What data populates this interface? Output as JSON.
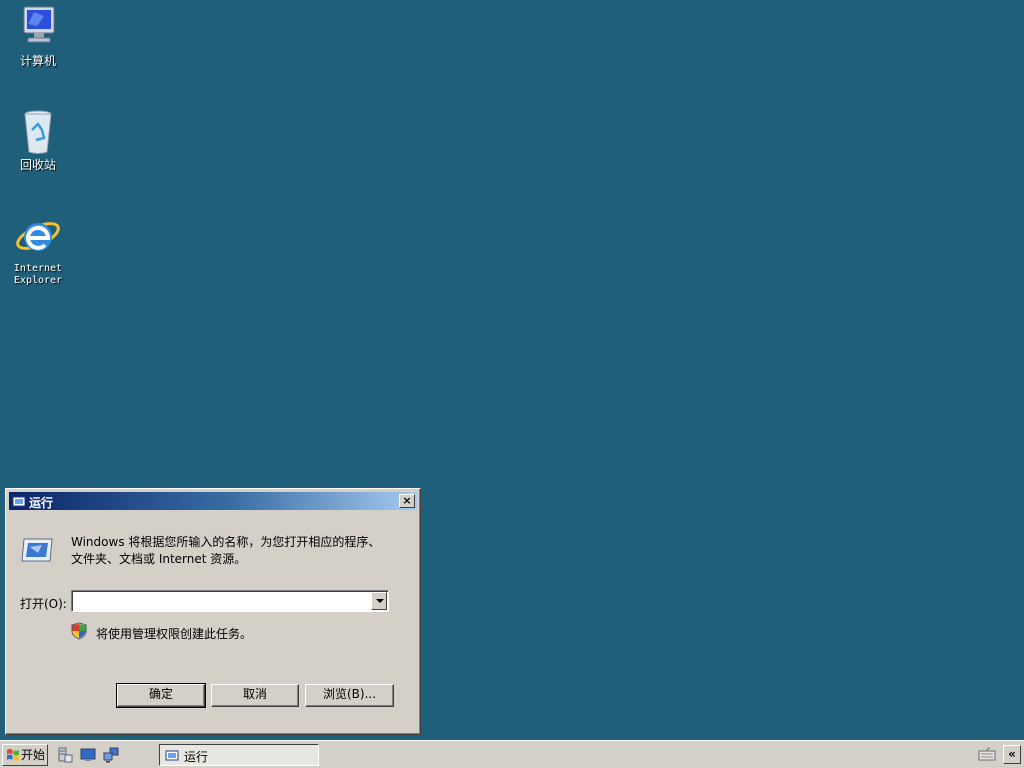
{
  "desktop": {
    "icons": [
      {
        "name": "computer",
        "label": "计算机"
      },
      {
        "name": "recycle-bin",
        "label": "回收站"
      },
      {
        "name": "internet-explorer",
        "label_line1": "Internet",
        "label_line2": "Explorer"
      }
    ],
    "background_color": "#1f5f7a"
  },
  "run_dialog": {
    "title": "运行",
    "close_label": "×",
    "description_line1": "Windows 将根据您所输入的名称，为您打开相应的程序、",
    "description_line2": "文件夹、文档或 Internet 资源。",
    "open_label": "打开(O):",
    "open_value": "",
    "admin_note": "将使用管理权限创建此任务。",
    "buttons": {
      "ok": "确定",
      "cancel": "取消",
      "browse": "浏览(B)..."
    }
  },
  "taskbar": {
    "start_label": "开始",
    "quick_launch": [
      "server-manager-icon",
      "show-desktop-icon",
      "network-icon"
    ],
    "active_task_label": "运行",
    "tray_expand_label": "«"
  }
}
